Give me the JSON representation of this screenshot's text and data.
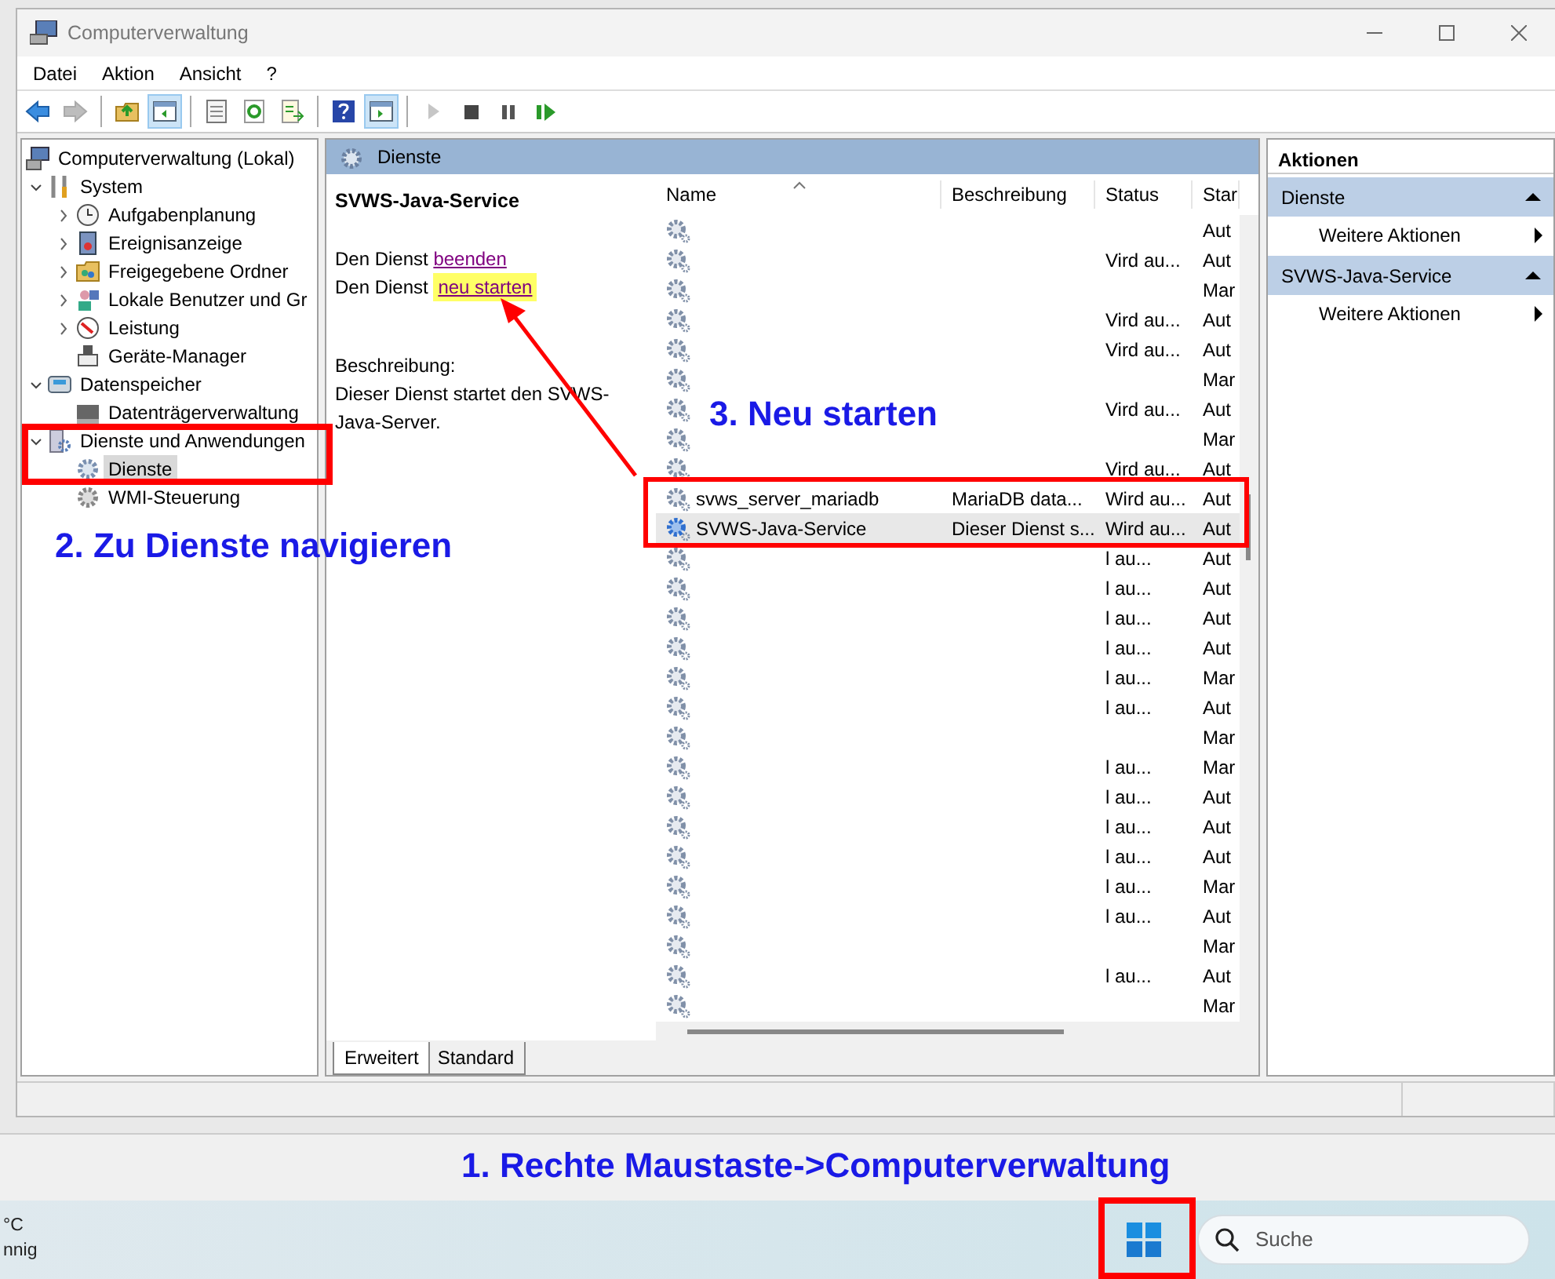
{
  "window": {
    "title": "Computerverwaltung"
  },
  "menu": [
    "Datei",
    "Aktion",
    "Ansicht",
    "?"
  ],
  "toolbar": [
    [
      {
        "disabled": false,
        "pressed": false
      },
      {
        "disabled": true,
        "pressed": false
      }
    ],
    [
      {
        "disabled": false,
        "pressed": false
      },
      {
        "disabled": false,
        "pressed": true
      }
    ],
    [
      {
        "disabled": false,
        "pressed": false
      },
      {
        "disabled": false,
        "pressed": false
      },
      {
        "disabled": false,
        "pressed": false
      }
    ],
    [
      {
        "disabled": false,
        "pressed": false
      },
      {
        "disabled": false,
        "pressed": true
      }
    ],
    [
      {
        "disabled": true,
        "pressed": false
      },
      {
        "disabled": false,
        "pressed": false
      },
      {
        "disabled": false,
        "pressed": false
      },
      {
        "disabled": false,
        "pressed": false
      }
    ]
  ],
  "tree": [
    {
      "label": "Computerverwaltung (Lokal)",
      "selected": false,
      "children": [
        {
          "label": "System",
          "expanded": true,
          "selected": false,
          "children": [
            {
              "label": "Aufgabenplanung",
              "expanded": false,
              "selected": false
            },
            {
              "label": "Ereignisanzeige",
              "expanded": false,
              "selected": false
            },
            {
              "label": "Freigegebene Ordner",
              "expanded": false,
              "selected": false
            },
            {
              "label": "Lokale Benutzer und Gr",
              "expanded": false,
              "selected": false
            },
            {
              "label": "Leistung",
              "expanded": false,
              "selected": false
            },
            {
              "label": "Geräte-Manager",
              "selected": false
            }
          ]
        },
        {
          "label": "Datenspeicher",
          "expanded": true,
          "selected": false,
          "children": [
            {
              "label": "Datenträgerverwaltung",
              "selected": false
            }
          ]
        },
        {
          "label": "Dienste und Anwendungen",
          "expanded": true,
          "selected": false,
          "children": [
            {
              "label": "Dienste",
              "selected": true
            },
            {
              "label": "WMI-Steuerung",
              "selected": false
            }
          ]
        }
      ]
    }
  ],
  "details": {
    "header": "Dienste",
    "title": "SVWS-Java-Service",
    "actions": [
      {
        "text": "Den Dienst",
        "link": "beenden",
        "highlighted": false
      },
      {
        "text": "Den Dienst",
        "link": "neu starten",
        "highlighted": true
      }
    ],
    "description_label": "Beschreibung:",
    "description": "Dieser Dienst startet den SVWS-Java-Server."
  },
  "services": {
    "columns": [
      {
        "label": "Name",
        "sorted": true
      },
      {
        "label": "Beschreibung",
        "sorted": false
      },
      {
        "label": "Status",
        "sorted": false
      },
      {
        "label": "Star",
        "sorted": false
      }
    ],
    "rows": [
      {
        "startup": "Aut",
        "selected": false
      },
      {
        "status": "Vird au...",
        "startup": "Aut",
        "selected": false
      },
      {
        "startup": "Mar",
        "selected": false
      },
      {
        "status": "Vird au...",
        "startup": "Aut",
        "selected": false
      },
      {
        "status": "Vird au...",
        "startup": "Aut",
        "selected": false
      },
      {
        "startup": "Mar",
        "selected": false
      },
      {
        "status": "Vird au...",
        "startup": "Aut",
        "selected": false
      },
      {
        "startup": "Mar",
        "selected": false
      },
      {
        "status": "Vird au...",
        "startup": "Aut",
        "selected": false
      },
      {
        "name": "svws_server_mariadb",
        "description": "MariaDB data...",
        "status": "Wird au...",
        "startup": "Aut",
        "selected": false
      },
      {
        "name": "SVWS-Java-Service",
        "description": "Dieser Dienst s...",
        "status": "Wird au...",
        "startup": "Aut",
        "selected": true
      },
      {
        "status": "l au...",
        "startup": "Aut",
        "selected": false
      },
      {
        "status": "l au...",
        "startup": "Aut",
        "selected": false
      },
      {
        "status": "l au...",
        "startup": "Aut",
        "selected": false
      },
      {
        "status": "l au...",
        "startup": "Aut",
        "selected": false
      },
      {
        "status": "l au...",
        "startup": "Mar",
        "selected": false
      },
      {
        "status": "l au...",
        "startup": "Aut",
        "selected": false
      },
      {
        "startup": "Mar",
        "selected": false
      },
      {
        "status": "l au...",
        "startup": "Mar",
        "selected": false
      },
      {
        "status": "l au...",
        "startup": "Aut",
        "selected": false
      },
      {
        "status": "l au...",
        "startup": "Aut",
        "selected": false
      },
      {
        "status": "l au...",
        "startup": "Aut",
        "selected": false
      },
      {
        "status": "l au...",
        "startup": "Mar",
        "selected": false
      },
      {
        "status": "l au...",
        "startup": "Aut",
        "selected": false
      },
      {
        "startup": "Mar",
        "selected": false
      },
      {
        "status": "l au...",
        "startup": "Aut",
        "selected": false
      },
      {
        "startup": "Mar",
        "selected": false
      }
    ]
  },
  "view_tabs": [
    {
      "label": "Erweitert",
      "selected": true
    },
    {
      "label": "Standard",
      "selected": false
    }
  ],
  "actions_pane": {
    "title": "Aktionen",
    "sections": [
      {
        "title": "Dienste",
        "expanded": true,
        "items": [
          "Weitere Aktionen"
        ]
      },
      {
        "title": "SVWS-Java-Service",
        "expanded": true,
        "items": [
          "Weitere Aktionen"
        ]
      }
    ]
  },
  "annotations": [
    "1. Rechte Maustaste->Computerverwaltung",
    "2. Zu Dienste navigieren",
    "3. Neu starten"
  ],
  "taskbar": {
    "weather": [
      "°C",
      "nnig"
    ],
    "search": {
      "placeholder": "Suche"
    }
  }
}
